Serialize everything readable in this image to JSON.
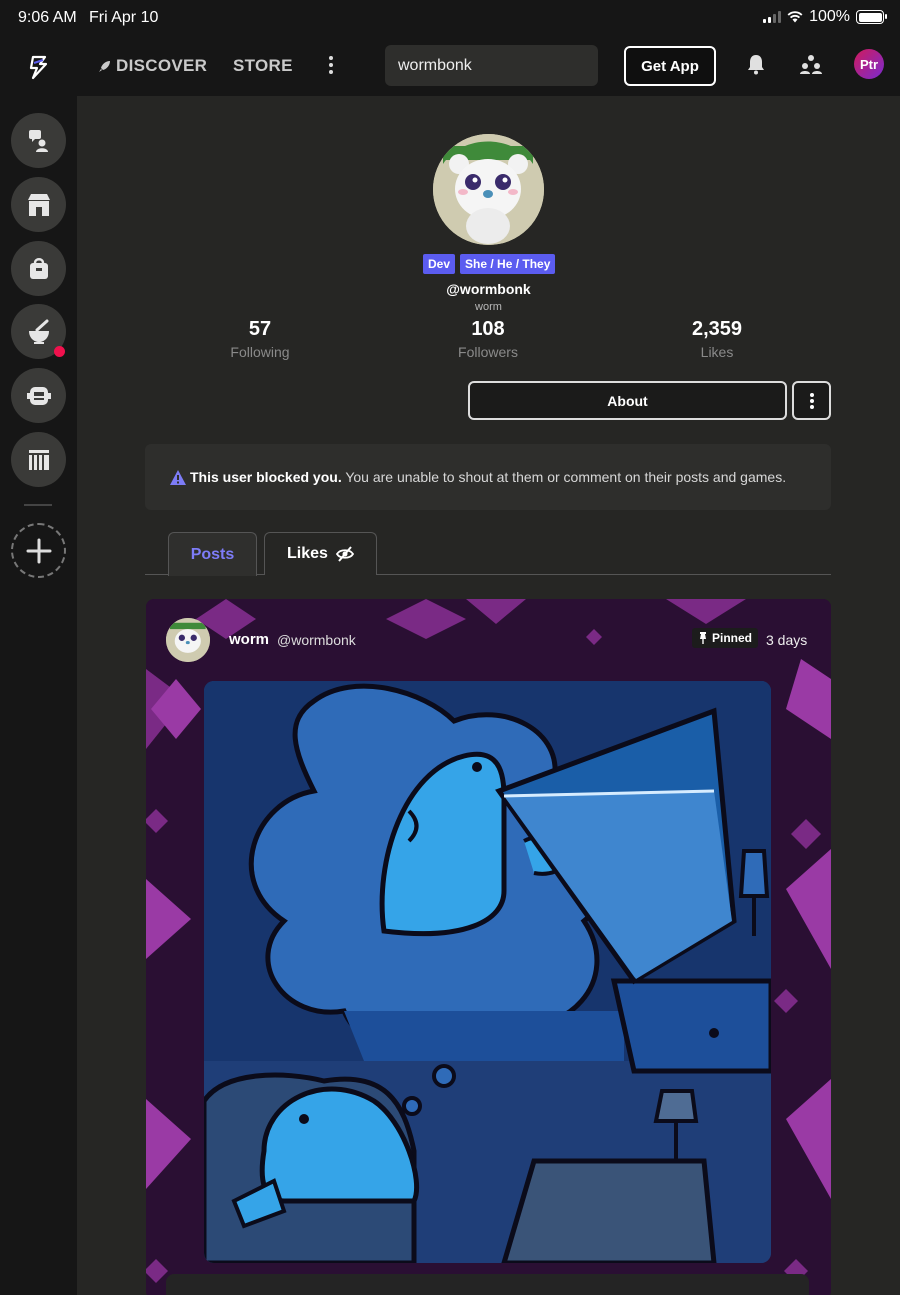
{
  "status_bar": {
    "time": "9:06 AM",
    "date": "Fri Apr 10",
    "battery": "100%"
  },
  "nav": {
    "discover": "DISCOVER",
    "store": "STORE",
    "search_value": "wormbonk",
    "get_app": "Get App",
    "user_initials": "Ptr"
  },
  "profile": {
    "badges": [
      "Dev",
      "She / He / They"
    ],
    "handle": "@wormbonk",
    "display_name": "worm",
    "stats": [
      {
        "value": "57",
        "label": "Following"
      },
      {
        "value": "108",
        "label": "Followers"
      },
      {
        "value": "2,359",
        "label": "Likes"
      }
    ],
    "about_label": "About"
  },
  "blocked_notice": {
    "bold": "This user blocked you.",
    "text": " You are unable to shout at them or comment on their posts and games."
  },
  "tabs": [
    {
      "label": "Posts",
      "active": true
    },
    {
      "label": "Likes",
      "active": false
    }
  ],
  "post": {
    "author_name": "worm",
    "author_handle": "@wormbonk",
    "pinned_label": "Pinned",
    "time": "3 days"
  },
  "colors": {
    "accent": "#5b5cf0",
    "tab_active": "#7d7cf7",
    "notification_dot": "#f0114d",
    "post_background": "#2a0f33"
  }
}
